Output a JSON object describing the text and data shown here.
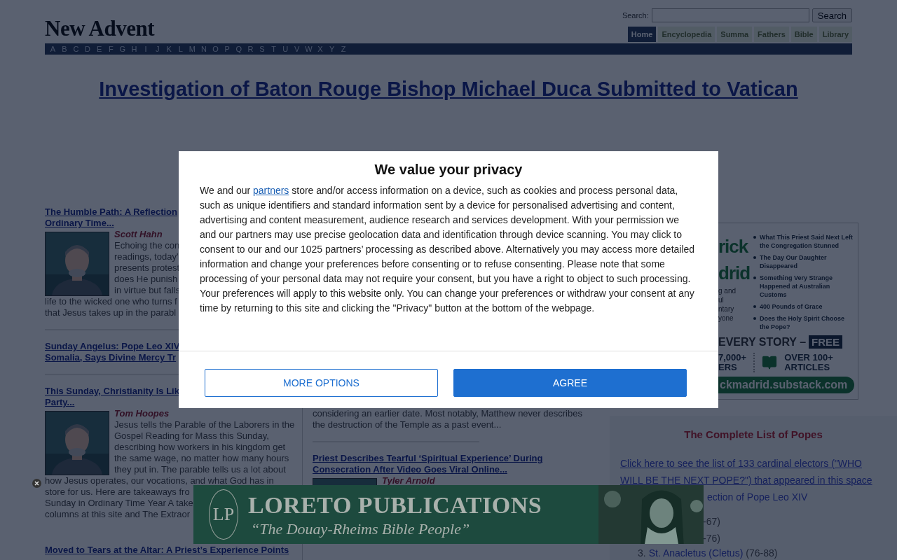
{
  "header": {
    "logo": "New Advent",
    "search": {
      "label": "Search:",
      "button": "Search"
    },
    "tabs": [
      {
        "label": "Home",
        "selected": true
      },
      {
        "label": "Encyclopedia",
        "selected": false
      },
      {
        "label": "Summa",
        "selected": false
      },
      {
        "label": "Fathers",
        "selected": false
      },
      {
        "label": "Bible",
        "selected": false
      },
      {
        "label": "Library",
        "selected": false
      }
    ],
    "letters": [
      "A",
      "B",
      "C",
      "D",
      "E",
      "F",
      "G",
      "H",
      "I",
      "J",
      "K",
      "L",
      "M",
      "N",
      "O",
      "P",
      "Q",
      "R",
      "S",
      "T",
      "U",
      "V",
      "W",
      "X",
      "Y",
      "Z"
    ]
  },
  "headline": "Investigation of Baton Rouge Bishop Michael Duca Submitted to Vatican",
  "left_articles": [
    {
      "title_lines": [
        "The Humble Path: A Reflection",
        "Ordinary Time..."
      ],
      "author": "Scott Hahn",
      "body_lines": [
        "Echoing the con",
        "readings, today'",
        "presents protest",
        "does He punish",
        "in virtue but falls",
        "life to the wicked one who turns f",
        "that Jesus takes up in the parabl"
      ]
    },
    {
      "title_lines": [
        "Sunday Angelus: Pope Leo XIV",
        "Somalia, Says Divine Mercy Tr"
      ]
    },
    {
      "title_lines": [
        "This Sunday, Christianity Is Lik",
        "Party..."
      ],
      "author": "Tom Hoopes",
      "body_lines": [
        "Jesus tells the Parable of the Laborers in the",
        "Gospel Reading for Mass this Sunday,",
        "describing how workers in his kingdom get",
        "the same wage, no matter how many hours",
        "they put in. The parable tells us a lot about",
        "how Jesus operates, our vocations, and what God has in",
        "store for us. Here are takeaways fro",
        "Sunday in Ordinary Time Year A take",
        "columns at this site and The Extraor"
      ]
    },
    {
      "title_lines": [
        "Moved to Tears at the Altar: A Priest’s Experience Points"
      ]
    }
  ],
  "middle_column": {
    "body_lines": [
      "considering an earlier date. Most notably, Matthew never describes",
      "the destruction of the Temple as a past event..."
    ],
    "article": {
      "title_lines": [
        "Priest Describes Tearful ‘Spiritual Experience’ During",
        "Consecration After Video Goes Viral Online..."
      ],
      "author": "Tyler Arnold"
    }
  },
  "sidebar_ad": {
    "name_fragments": [
      "rick",
      "drid"
    ],
    "tagline_fragments": [
      "g and",
      "ul",
      "ntary",
      "yone"
    ],
    "bullets": [
      "What This Priest Said Next Left the Congregation Stunned",
      "The Day Our Daughter Disappeared",
      "Something Very Strange Happened at Australian Customs",
      "400 Pounds of Grace",
      "Does the Holy Spirit Choose the Pope?"
    ],
    "promo": "EVERY STORY –",
    "badge": "FREE",
    "stat_readers": [
      "7,000+",
      "ERS"
    ],
    "stat_articles": [
      "OVER 100+",
      "ARTICLES"
    ],
    "url": "ckmadrid.substack.com"
  },
  "popes": {
    "heading": "The Complete List of Popes",
    "link": "Click here to see the list of 133 cardinal electors (\"WHO WILL BE THE NEXT POPE?\") that appeared in this space",
    "continuation": "ection of Pope Leo XIV",
    "fragments": [
      "-67)",
      "-76)"
    ],
    "item": {
      "number": "3.",
      "name": "St. Anacletus (Cletus)",
      "years": "(76-88)"
    }
  },
  "banner": {
    "monogram": "LP",
    "title": "LORETO PUBLICATIONS",
    "tagline": "“The Douay-Rheims Bible People”"
  },
  "consent": {
    "title": "We value your privacy",
    "body_before": "We and our",
    "link": "partners",
    "body_after": "store and/or access information on a device, such as cookies and process personal data, such as unique identifiers and standard information sent by a device for personalised advertising and content, advertising and content measurement, audience research and services development. With your permission we and our partners may use precise geolocation data and identification through device scanning. You may click to consent to our and our 1025 partners’ processing as described above. Alternatively you may access more detailed information and change your preferences before consenting or to refuse consenting. Please note that some processing of your personal data may not require your consent, but you have a right to object to such processing. Your preferences will apply to this website only. You can change your preferences or withdraw your consent at any time by returning to this site and clicking the \"Privacy\" button at the bottom of the webpage.",
    "buttons": [
      {
        "label": "MORE OPTIONS",
        "kind": "outline"
      },
      {
        "label": "AGREE",
        "kind": "primary"
      }
    ]
  }
}
